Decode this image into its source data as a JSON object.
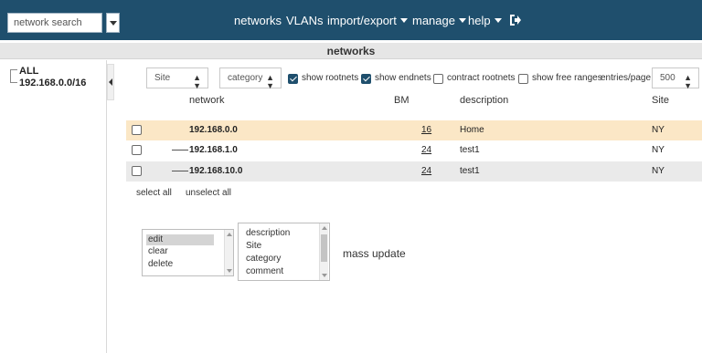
{
  "topnav": {
    "search_placeholder": "network search",
    "menus": [
      {
        "label": "networks",
        "has_caret": false
      },
      {
        "label": "VLANs",
        "has_caret": false
      },
      {
        "label": "import/export",
        "has_caret": true
      },
      {
        "label": "manage",
        "has_caret": true
      },
      {
        "label": "help",
        "has_caret": true
      }
    ],
    "logout_icon": "sign-out-icon",
    "bg_color": "#1f4f6d"
  },
  "section_title": "networks",
  "tree": {
    "items": [
      {
        "label": "ALL"
      },
      {
        "label": "192.168.0.0/16"
      }
    ]
  },
  "filters": {
    "site_select": "Site",
    "category_select": "category",
    "show_rootnets_label": "show rootnets",
    "show_rootnets_checked": true,
    "show_endnets_label": "show endnets",
    "show_endnets_checked": true,
    "contract_rootnets_label": "contract rootnets",
    "contract_rootnets_checked": false,
    "show_free_ranges_label": "show free ranges",
    "show_free_ranges_checked": false,
    "entries_label": "entries/page",
    "entries_value": "500"
  },
  "table": {
    "columns": [
      "network",
      "BM",
      "description",
      "Site"
    ],
    "rows": [
      {
        "network": "192.168.0.0",
        "bm": "16",
        "description": "Home",
        "site": "NY",
        "checked": false,
        "indented": false
      },
      {
        "network": "192.168.1.0",
        "bm": "24",
        "description": "test1",
        "site": "NY",
        "checked": false,
        "indented": true
      },
      {
        "network": "192.168.10.0",
        "bm": "24",
        "description": "test1",
        "site": "NY",
        "checked": false,
        "indented": true
      }
    ]
  },
  "links": {
    "select_all": "select all",
    "unselect_all": "unselect all"
  },
  "mass_update": {
    "actions": [
      "edit",
      "clear",
      "delete"
    ],
    "selected_action": "edit",
    "fields": [
      "description",
      "Site",
      "category",
      "comment"
    ],
    "label": "mass update"
  }
}
